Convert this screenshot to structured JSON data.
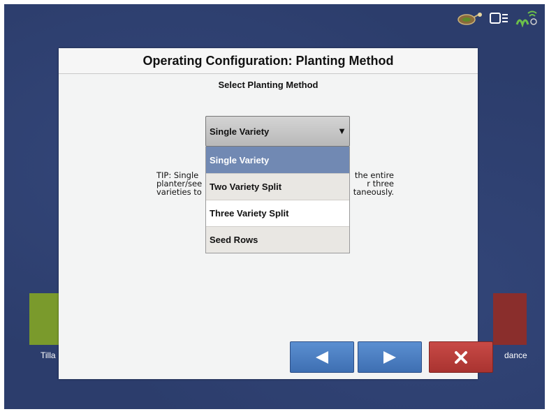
{
  "dialog": {
    "title": "Operating Configuration: Planting Method",
    "subtitle": "Select Planting Method",
    "tip_lines": [
      "TIP: Single",
      "planter/see",
      "varieties to"
    ],
    "tip_lines_right": [
      "the entire",
      "r three",
      "taneously."
    ]
  },
  "select": {
    "value": "Single Variety",
    "options": [
      "Single Variety",
      "Two Variety Split",
      "Three Variety Split",
      "Seed Rows"
    ]
  },
  "buttons": {
    "back_icon": "left-triangle",
    "next_icon": "right-triangle",
    "cancel_icon": "x-mark"
  },
  "background": {
    "left_label": "Tilla",
    "right_label": "dance"
  },
  "status_icons": [
    "gps-antenna-icon",
    "display-icon",
    "satellite-signal-icon"
  ],
  "colors": {
    "selected_option": "#7189b3",
    "nav_button": "#4a7cc0",
    "cancel_button": "#b43a37",
    "screen_bg": "#2c3d6c"
  }
}
